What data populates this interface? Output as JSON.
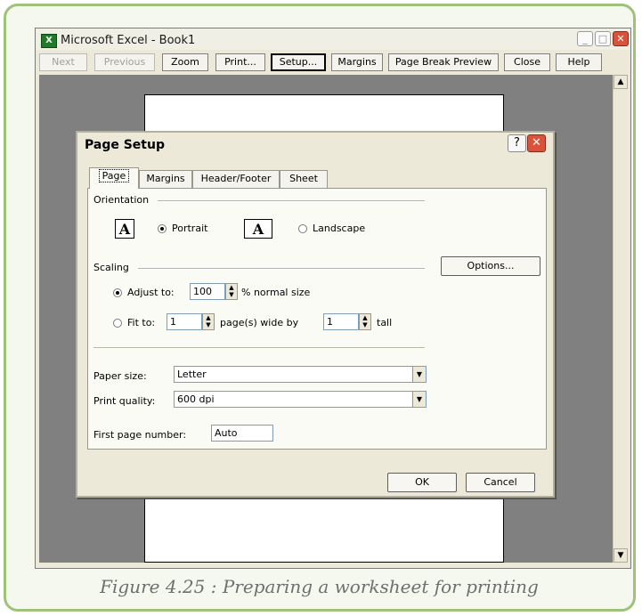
{
  "window": {
    "title": "Microsoft Excel - Book1",
    "app_icon_glyph": "X",
    "minimize": "_",
    "maximize": "□",
    "close": "✕"
  },
  "toolbar": {
    "next": "Next",
    "previous": "Previous",
    "zoom": "Zoom",
    "print": "Print...",
    "setup": "Setup...",
    "margins": "Margins",
    "page_break_preview": "Page Break Preview",
    "close": "Close",
    "help": "Help"
  },
  "scrollbar": {
    "up": "▲",
    "down": "▼"
  },
  "dialog": {
    "title": "Page Setup",
    "help_glyph": "?",
    "close_glyph": "✕",
    "tabs": [
      "Page",
      "Margins",
      "Header/Footer",
      "Sheet"
    ],
    "active_tab": "Page",
    "orientation": {
      "label": "Orientation",
      "portrait": "Portrait",
      "landscape": "Landscape",
      "icon_glyph": "A",
      "selected": "Portrait"
    },
    "scaling": {
      "label": "Scaling",
      "adjust_to_label": "Adjust to:",
      "adjust_value": "100",
      "adjust_suffix": "% normal size",
      "fit_to_label": "Fit to:",
      "fit_wide": "1",
      "wide_suffix": "page(s) wide by",
      "fit_tall": "1",
      "tall_suffix": "tall",
      "selected": "Adjust to"
    },
    "options_button": "Options...",
    "paper_size": {
      "label": "Paper size:",
      "value": "Letter"
    },
    "print_quality": {
      "label": "Print quality:",
      "value": "600 dpi"
    },
    "first_page": {
      "label": "First page number:",
      "value": "Auto"
    },
    "ok": "OK",
    "cancel": "Cancel"
  },
  "caption": "Figure 4.25 : Preparing a worksheet for printing",
  "colors": {
    "frame_border": "#9fc27a",
    "preview_bg": "#808080",
    "title_close": "#d9533a"
  }
}
